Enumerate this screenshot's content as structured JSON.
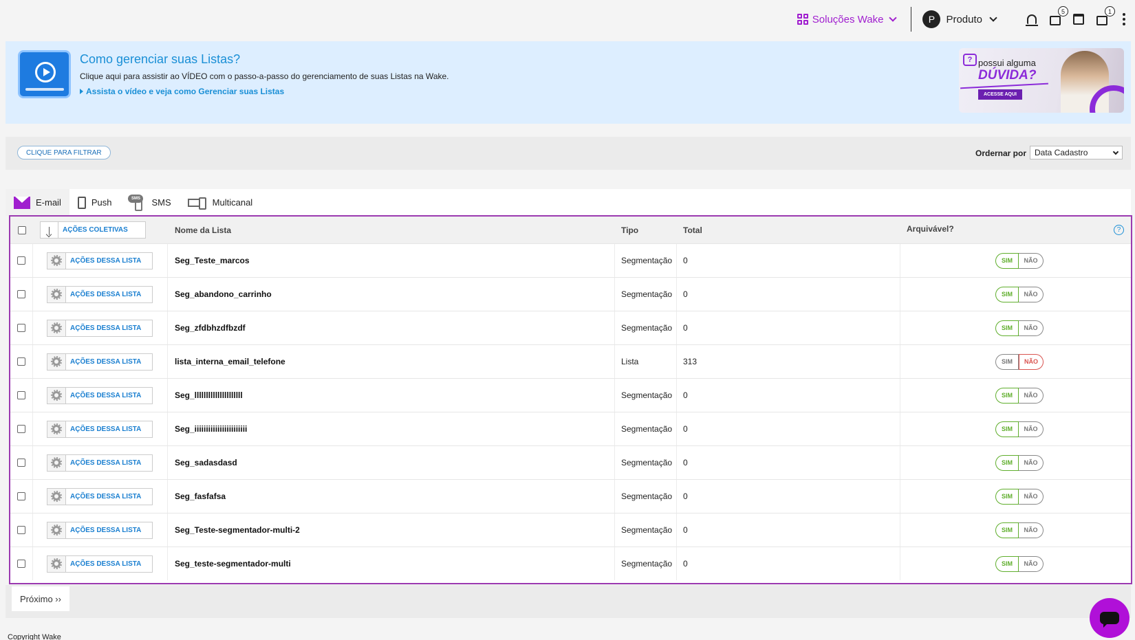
{
  "topbar": {
    "solucoes_label": "Soluções Wake",
    "user_initial": "P",
    "produto_label": "Produto",
    "inbox_badge": "5",
    "download_badge": "1"
  },
  "banner": {
    "title": "Como gerenciar suas Listas?",
    "text": "Clique aqui para assistir ao VÍDEO com o passo-a-passo do gerenciamento de suas Listas na Wake.",
    "link": "Assista o vídeo e veja como Gerenciar suas Listas",
    "promo_line1": "possui alguma",
    "promo_line2": "DÚVIDA?",
    "promo_button": "ACESSE AQUI"
  },
  "filterbar": {
    "filter_button": "CLIQUE PARA FILTRAR",
    "order_label": "Ordernar por",
    "order_value": "Data Cadastro"
  },
  "tabs": [
    {
      "label": "E-mail",
      "icon": "envelope-icon"
    },
    {
      "label": "Push",
      "icon": "phone-icon"
    },
    {
      "label": "SMS",
      "icon": "sms-icon"
    },
    {
      "label": "Multicanal",
      "icon": "multichannel-icon"
    }
  ],
  "table": {
    "bulk_actions": "AÇÕES COLETIVAS",
    "headers": {
      "name": "Nome da Lista",
      "tipo": "Tipo",
      "total": "Total",
      "arquivavel": "Arquivável?"
    },
    "row_action_label": "AÇÕES DESSA LISTA",
    "sim_label": "SIM",
    "nao_label": "NÃO",
    "rows": [
      {
        "name": "Seg_Teste_marcos",
        "tipo": "Segmentação",
        "total": "0",
        "arquivavel": "SIM"
      },
      {
        "name": "Seg_abandono_carrinho",
        "tipo": "Segmentação",
        "total": "0",
        "arquivavel": "SIM"
      },
      {
        "name": "Seg_zfdbhzdfbzdf",
        "tipo": "Segmentação",
        "total": "0",
        "arquivavel": "SIM"
      },
      {
        "name": "lista_interna_email_telefone",
        "tipo": "Lista",
        "total": "313",
        "arquivavel": "NÃO"
      },
      {
        "name": "Seg_lllllllllllllllllllll",
        "tipo": "Segmentação",
        "total": "0",
        "arquivavel": "SIM"
      },
      {
        "name": "Seg_iiiiiiiiiiiiiiiiiiiiiii",
        "tipo": "Segmentação",
        "total": "0",
        "arquivavel": "SIM"
      },
      {
        "name": "Seg_sadasdasd",
        "tipo": "Segmentação",
        "total": "0",
        "arquivavel": "SIM"
      },
      {
        "name": "Seg_fasfafsa",
        "tipo": "Segmentação",
        "total": "0",
        "arquivavel": "SIM"
      },
      {
        "name": "Seg_Teste-segmentador-multi-2",
        "tipo": "Segmentação",
        "total": "0",
        "arquivavel": "SIM"
      },
      {
        "name": "Seg_teste-segmentador-multi",
        "tipo": "Segmentação",
        "total": "0",
        "arquivavel": "SIM"
      }
    ]
  },
  "pager": {
    "next_label": "Próximo ››"
  },
  "footer": {
    "copyright": "Copyright Wake"
  },
  "colors": {
    "brand": "#a01ecf",
    "link": "#1a8fd6",
    "sim": "#5fae2c",
    "nao": "#d9534f",
    "table_border": "#9b39b0"
  }
}
